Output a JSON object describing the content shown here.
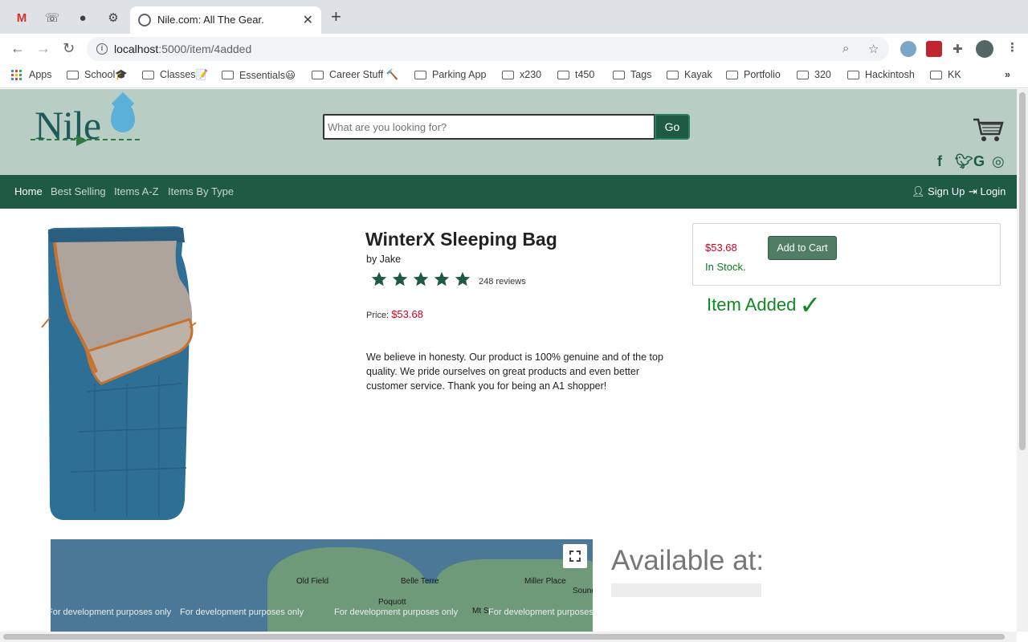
{
  "browser": {
    "pinned_tabs": [
      "gmail-icon",
      "phone-icon",
      "github-icon",
      "settings-icon"
    ],
    "tab_title": "Nile.com: All The Gear.",
    "url_host": "localhost",
    "url_path": ":5000/item/4added",
    "bookmarks": [
      "Apps",
      "School🎓",
      "Classes📝",
      "Essentials😃",
      "Career Stuff 🔨",
      "Parking App",
      "x230",
      "t450",
      "Tags",
      "Kayak",
      "Portfolio",
      "320",
      "Hackintosh",
      "KK"
    ]
  },
  "site": {
    "logo_text": "Nile",
    "search_placeholder": "What are you looking for?",
    "go_label": "Go",
    "nav": {
      "home": "Home",
      "best_selling": "Best Selling",
      "items_az": "Items A-Z",
      "items_by_type": "Items By Type",
      "sign_up": "Sign Up",
      "login": "Login"
    }
  },
  "product": {
    "title": "WinterX Sleeping Bag",
    "byline": "by Jake",
    "rating_stars": 5,
    "reviews": "248 reviews",
    "price_label": "Price:",
    "price": "$53.68",
    "description": "We believe in honesty. Our product is 100% genuine and of the top quality. We pride ourselves on great products and even better customer service. Thank you for being an A1 shopper!"
  },
  "buy_box": {
    "price": "$53.68",
    "stock": "In Stock.",
    "add_to_cart": "Add to Cart",
    "added_message": "Item Added",
    "check": "✓"
  },
  "map": {
    "labels": [
      "Old Field",
      "Belle Terre",
      "Miller Place",
      "Poquott",
      "Sound",
      "Mt S"
    ],
    "dev_watermark": "For development purposes only"
  },
  "availability": {
    "title": "Available at:"
  },
  "colors": {
    "header_bg": "#b8cdc4",
    "nav_bg": "#1f5a44",
    "price_red": "#d0021b",
    "success_green": "#0f8a22"
  }
}
